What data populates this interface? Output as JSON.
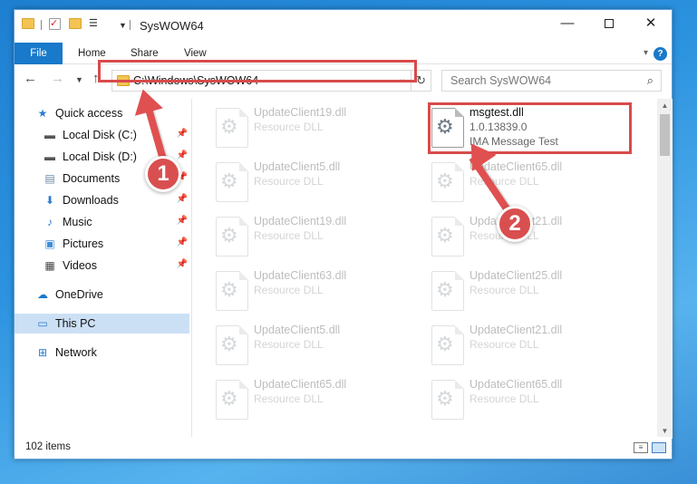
{
  "window": {
    "title": "SysWOW64",
    "controls": {
      "minimize": "—",
      "maximize": "",
      "close": "✕"
    }
  },
  "ribbon": {
    "tabs": [
      "File",
      "Home",
      "Share",
      "View"
    ],
    "help": "?"
  },
  "address_bar": {
    "path": "C:\\Windows\\SysWOW64",
    "refresh_glyph": "↻"
  },
  "search": {
    "placeholder": "Search SysWOW64"
  },
  "sidebar": {
    "items": [
      {
        "label": "Quick access",
        "icon": "star-icon"
      },
      {
        "label": "Local Disk (C:)",
        "icon": "drive-icon",
        "pinned": true
      },
      {
        "label": "Local Disk (D:)",
        "icon": "drive-icon",
        "pinned": true
      },
      {
        "label": "Documents",
        "icon": "documents-icon",
        "pinned": true
      },
      {
        "label": "Downloads",
        "icon": "download-icon",
        "pinned": true
      },
      {
        "label": "Music",
        "icon": "music-icon",
        "pinned": true
      },
      {
        "label": "Pictures",
        "icon": "pictures-icon",
        "pinned": true
      },
      {
        "label": "Videos",
        "icon": "videos-icon",
        "pinned": true
      },
      {
        "label": "OneDrive",
        "icon": "cloud-icon"
      },
      {
        "label": "This PC",
        "icon": "computer-icon",
        "selected": true
      },
      {
        "label": "Network",
        "icon": "network-icon"
      }
    ]
  },
  "files": {
    "highlighted": {
      "name": "msgtest.dll",
      "version": "1.0.13839.0",
      "description": "IMA Message Test"
    },
    "left_column": [
      {
        "name": "UpdateClient19.dll",
        "type": "Resource DLL"
      },
      {
        "name": "UpdateClient5.dll",
        "type": "Resource DLL"
      },
      {
        "name": "UpdateClient19.dll",
        "type": "Resource DLL"
      },
      {
        "name": "UpdateClient63.dll",
        "type": "Resource DLL"
      },
      {
        "name": "UpdateClient5.dll",
        "type": "Resource DLL"
      },
      {
        "name": "UpdateClient65.dll",
        "type": "Resource DLL"
      }
    ],
    "right_column": [
      {
        "name": "UpdateClient65.dll",
        "type": "Resource DLL"
      },
      {
        "name": "UpdateClient21.dll",
        "type": "Resource DLL"
      },
      {
        "name": "UpdateClient25.dll",
        "type": "Resource DLL"
      },
      {
        "name": "UpdateClient21.dll",
        "type": "Resource DLL"
      },
      {
        "name": "UpdateClient65.dll",
        "type": "Resource DLL"
      }
    ]
  },
  "status": {
    "item_count": "102 items"
  },
  "callouts": {
    "step1": "1",
    "step2": "2"
  },
  "colors": {
    "accent": "#1979ca",
    "highlight": "#d84b4b",
    "selection": "#cce0f5"
  }
}
